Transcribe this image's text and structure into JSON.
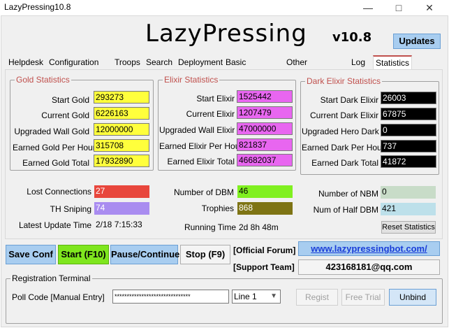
{
  "window": {
    "title": "LazyPressing10.8"
  },
  "header": {
    "logo": "LazyPressing",
    "version": "v10.8",
    "updates_label": "Updates"
  },
  "tabs": [
    "Helpdesk",
    "Configuration Set",
    "Troops",
    "Search",
    "Deployment",
    "Basic Functions",
    "Other Functions",
    "Log",
    "Statistics"
  ],
  "active_tab": "Statistics",
  "gold": {
    "title": "Gold Statistics",
    "rows": [
      {
        "label": "Start Gold",
        "value": "293273"
      },
      {
        "label": "Current Gold",
        "value": "6226163"
      },
      {
        "label": "Upgraded Wall Gold",
        "value": "12000000"
      },
      {
        "label": "Earned Gold Per Hour",
        "value": "315708"
      },
      {
        "label": "Earned Gold Total",
        "value": "17932890"
      }
    ]
  },
  "elixir": {
    "title": "Elixir Statistics",
    "rows": [
      {
        "label": "Start Elixir",
        "value": "1525442"
      },
      {
        "label": "Current Elixir",
        "value": "1207479"
      },
      {
        "label": "Upgraded Wall Elixir",
        "value": "47000000"
      },
      {
        "label": "Earned Elixir Per Hour",
        "value": "821837"
      },
      {
        "label": "Earned Elixir Total",
        "value": "46682037"
      }
    ]
  },
  "dark": {
    "title": "Dark Elixir Statistics",
    "rows": [
      {
        "label": "Start Dark Elixir",
        "value": "26003"
      },
      {
        "label": "Current Dark Elixir",
        "value": "67875"
      },
      {
        "label": "Upgraded Hero Dark",
        "value": "0"
      },
      {
        "label": "Earned Dark Per Hour",
        "value": "737"
      },
      {
        "label": "Earned Dark Total",
        "value": "41872"
      }
    ]
  },
  "misc": {
    "lost_connections": {
      "label": "Lost Connections",
      "value": "27"
    },
    "th_sniping": {
      "label": "TH Sniping",
      "value": "74"
    },
    "last_update": {
      "label": "Latest Update Time",
      "value": "2/18 7:15:33"
    },
    "dbm": {
      "label": "Number of DBM",
      "value": "46"
    },
    "trophies": {
      "label": "Trophies",
      "value": "868"
    },
    "running_time": {
      "label": "Running Time",
      "value": "2d 8h 48m"
    },
    "nbm": {
      "label": "Number of NBM",
      "value": "0"
    },
    "half_dbm": {
      "label": "Num of Half DBM",
      "value": "421"
    },
    "reset_label": "Reset Statistics"
  },
  "controls": {
    "save": "Save Conf",
    "start": "Start (F10)",
    "pause": "Pause/Continue",
    "stop": "Stop (F9)",
    "forum_label": "[Official Forum]",
    "forum_link": "www.lazypressingbot.com/",
    "support_label": "[Support Team]",
    "support_email": "423168181@qq.com"
  },
  "registration": {
    "title": "Registration Terminal",
    "poll_label": "Poll Code [Manual Entry]",
    "poll_value": "*******************************",
    "line_value": "Line 1",
    "regist": "Regist",
    "free_trial": "Free Trial",
    "unbind": "Unbind"
  },
  "colors": {
    "gold": "#ffff3c",
    "elixir": "#e866f0",
    "dark": "#000000",
    "lost": "#e8463c",
    "th": "#a98cf0",
    "dbm": "#80f020",
    "trophies": "#7e7414",
    "nbm": "#c8dcc8",
    "halfdbm": "#bde0ea"
  }
}
